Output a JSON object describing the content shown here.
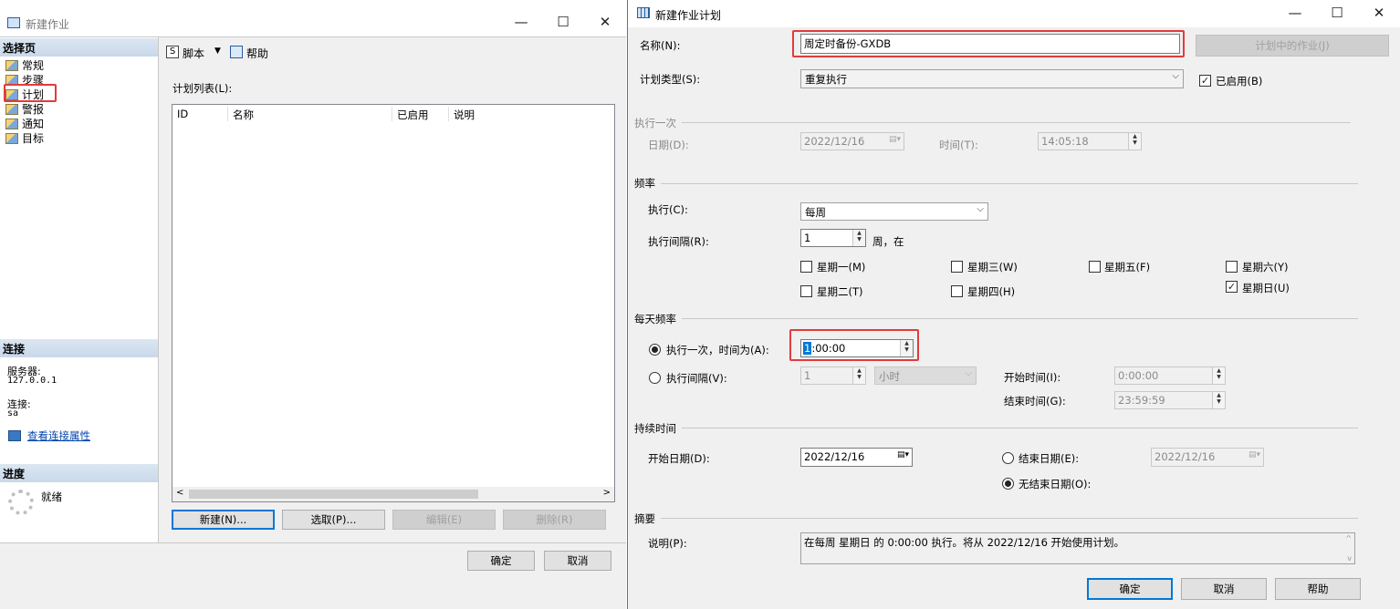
{
  "left": {
    "title": "新建作业",
    "select_page": "选择页",
    "nav": [
      "常规",
      "步骤",
      "计划",
      "警报",
      "通知",
      "目标"
    ],
    "toolbar": {
      "script": "脚本",
      "help": "帮助"
    },
    "schedule_list_label": "计划列表(L):",
    "columns": [
      "ID",
      "名称",
      "已启用",
      "说明"
    ],
    "connection": {
      "header": "连接",
      "server_label": "服务器:",
      "server": "127.0.0.1",
      "conn_label": "连接:",
      "conn": "sa",
      "view_props": "查看连接属性"
    },
    "progress": {
      "header": "进度",
      "status": "就绪"
    },
    "buttons": {
      "new": "新建(N)...",
      "pick": "选取(P)...",
      "edit": "编辑(E)",
      "delete": "删除(R)"
    },
    "ok": "确定",
    "cancel": "取消"
  },
  "right": {
    "title": "新建作业计划",
    "name_label": "名称(N):",
    "name_value": "周定时备份-GXDB",
    "jobs_in_schedule": "计划中的作业(J)",
    "type_label": "计划类型(S):",
    "type_value": "重复执行",
    "enabled_label": "已启用(B)",
    "once": {
      "header": "执行一次",
      "date_label": "日期(D):",
      "date": "2022/12/16",
      "time_label": "时间(T):",
      "time": "14:05:18"
    },
    "freq": {
      "header": "频率",
      "exec_label": "执行(C):",
      "exec_value": "每周",
      "interval_label": "执行间隔(R):",
      "interval_value": "1",
      "interval_suffix": "周，在",
      "days": [
        "星期一(M)",
        "星期二(T)",
        "星期三(W)",
        "星期四(H)",
        "星期五(F)",
        "星期六(Y)",
        "星期日(U)"
      ],
      "days_checked": [
        false,
        false,
        false,
        false,
        false,
        false,
        true
      ]
    },
    "daily": {
      "header": "每天频率",
      "once_label": "执行一次，时间为(A):",
      "once_time_sel": "1",
      "once_time_rest": ":00:00",
      "interval_label": "执行间隔(V):",
      "interval_value": "1",
      "interval_unit": "小时",
      "start_label": "开始时间(I):",
      "start": "0:00:00",
      "end_label": "结束时间(G):",
      "end": "23:59:59"
    },
    "duration": {
      "header": "持续时间",
      "start_label": "开始日期(D):",
      "start": "2022/12/16",
      "end_label": "结束日期(E):",
      "end": "2022/12/16",
      "no_end_label": "无结束日期(O):"
    },
    "summary": {
      "header": "摘要",
      "desc_label": "说明(P):",
      "desc": "在每周 星期日 的 0:00:00 执行。将从 2022/12/16 开始使用计划。"
    },
    "ok": "确定",
    "cancel": "取消",
    "help": "帮助"
  }
}
